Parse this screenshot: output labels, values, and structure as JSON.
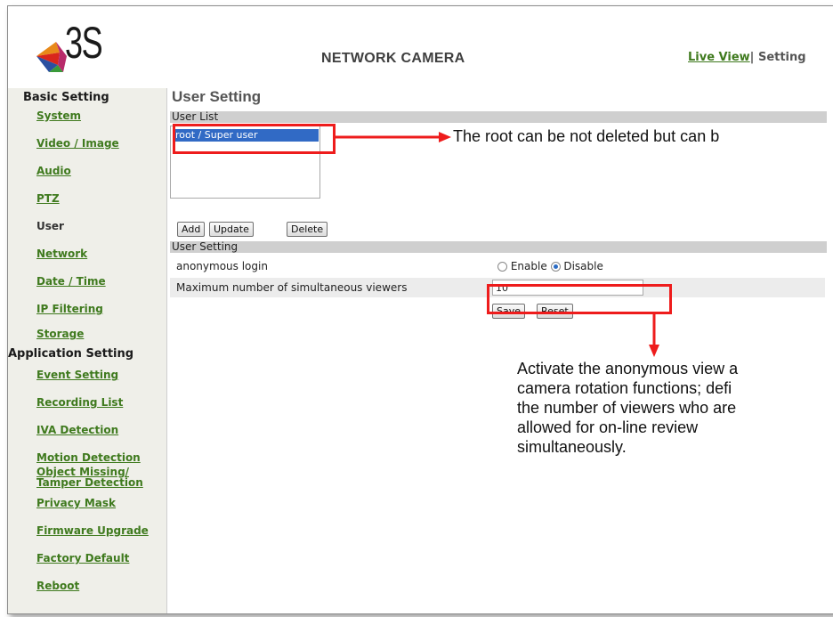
{
  "header": {
    "logo_text": "3S",
    "title": "NETWORK CAMERA",
    "live_view": "Live View",
    "separator": "|",
    "setting": "Setting"
  },
  "sidebar": {
    "basic_heading": "Basic Setting",
    "basic_items": [
      "System",
      "Video / Image",
      "Audio",
      "PTZ",
      "User",
      "Network",
      "Date / Time",
      "IP Filtering",
      "Storage"
    ],
    "app_heading": "Application Setting",
    "app_items": [
      "Event Setting",
      "Recording List",
      "IVA Detection",
      "Motion Detection",
      "Object Missing/",
      "Tamper Detection",
      "Privacy Mask",
      "Firmware Upgrade",
      "Factory Default",
      "Reboot"
    ]
  },
  "main": {
    "title": "User Setting",
    "user_list_header": "User List",
    "user_list_items": [
      "root  /  Super user"
    ],
    "buttons": {
      "add": "Add",
      "update": "Update",
      "delete": "Delete",
      "save": "Save",
      "reset": "Reset"
    },
    "user_setting_header": "User Setting",
    "anonymous_label": "anonymous login",
    "enable_label": "Enable",
    "disable_label": "Disable",
    "anonymous_value": "Disable",
    "max_viewers_label": "Maximum number of simultaneous viewers",
    "max_viewers_value": "10"
  },
  "annotations": {
    "root_note": "The root can be not deleted but can b",
    "anonymous_note": [
      "Activate the anonymous view a",
      "camera rotation functions; defi",
      "the number of viewers who are",
      "allowed for on-line review",
      "simultaneously."
    ]
  },
  "colors": {
    "link_green": "#3f7a1e",
    "annotation_red": "#ee1c1c",
    "selection_blue": "#316ac5",
    "bar_gray": "#cfcfcf",
    "sidebar_bg": "#efefe9"
  }
}
